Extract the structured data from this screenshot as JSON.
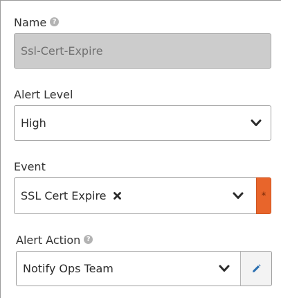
{
  "form": {
    "name": {
      "label": "Name",
      "value": "Ssl-Cert-Expire",
      "help_icon": "question-circle-icon"
    },
    "alert_level": {
      "label": "Alert Level",
      "selected": "High",
      "dropdown_icon": "chevron-down-icon"
    },
    "event": {
      "label": "Event",
      "selected_tag": "SSL Cert Expire",
      "remove_icon": "times-icon",
      "dropdown_icon": "chevron-down-icon",
      "required_marker": "*"
    },
    "alert_action": {
      "label": "Alert Action",
      "selected": "Notify Ops Team",
      "help_icon": "question-circle-icon",
      "dropdown_icon": "chevron-down-icon",
      "edit_icon": "pencil-icon"
    }
  },
  "colors": {
    "required_accent": "#e8652b",
    "disabled_bg": "#cccccc",
    "border": "#9e9e9e",
    "edit_icon": "#2a6fb0"
  }
}
